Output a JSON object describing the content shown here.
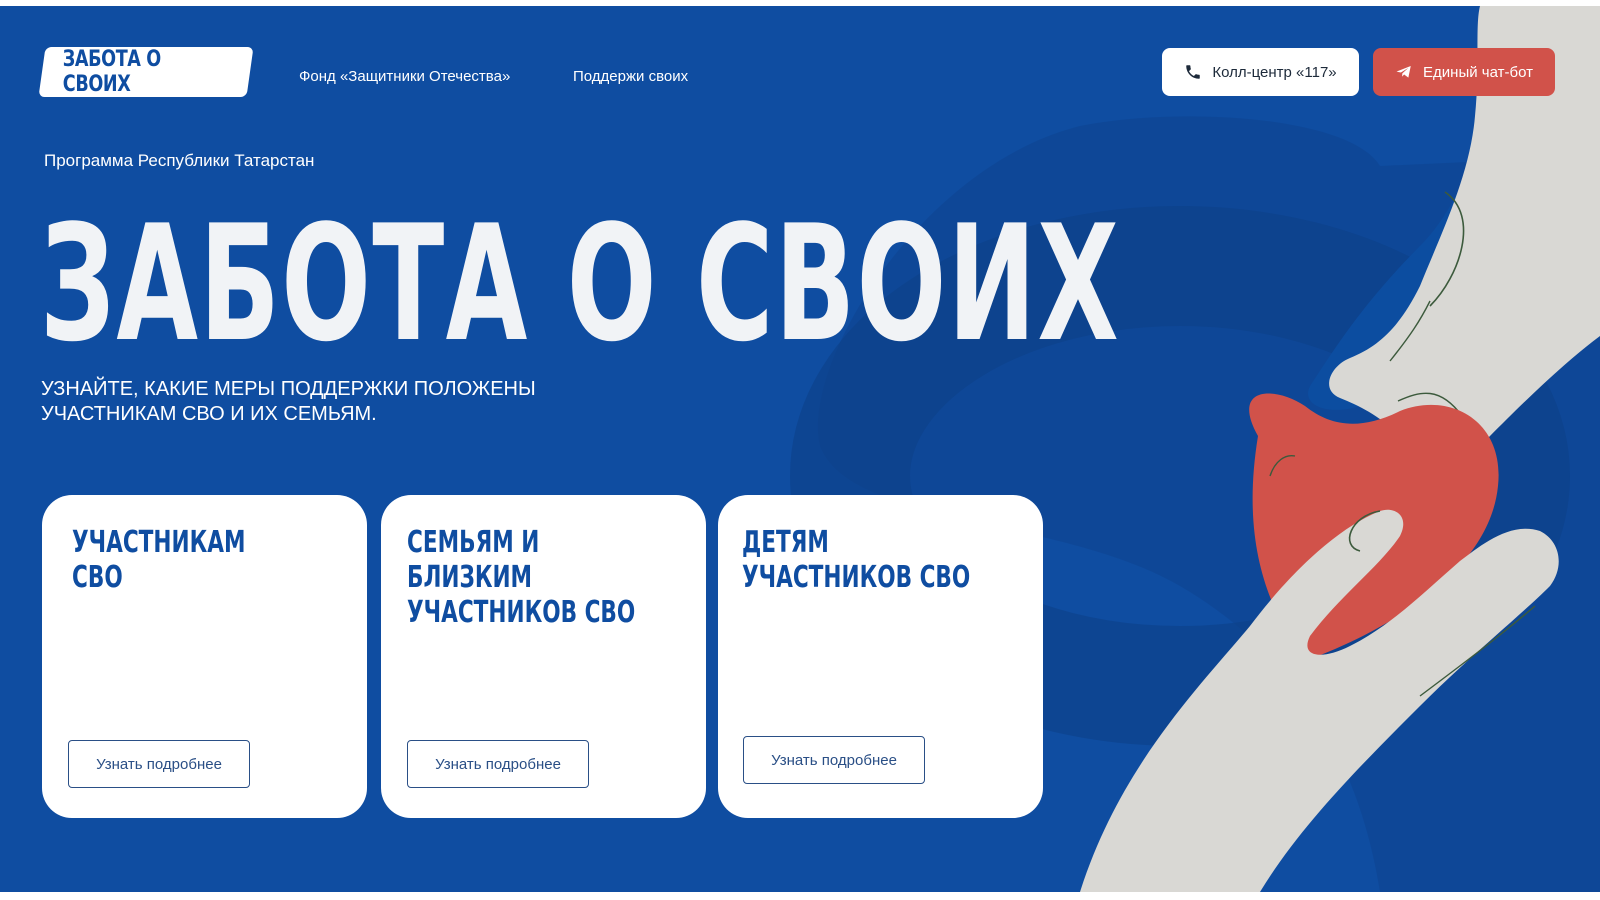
{
  "header": {
    "logo_text": "ЗАБОТА О СВОИХ",
    "nav": [
      {
        "label": "Фонд «Защитники Отечества»"
      },
      {
        "label": "Поддержи своих"
      }
    ],
    "call_center_label": "Колл-центр «117»",
    "chatbot_label": "Единый чат-бот"
  },
  "hero": {
    "program_label": "Программа Республики Татарстан",
    "title": "ЗАБОТА О СВОИХ",
    "subtitle_line1": "Узнайте, какие меры поддержки положены",
    "subtitle_line2": "участникам СВО и их семьям."
  },
  "cards": [
    {
      "title": "Участникам СВО",
      "button": "Узнать подробнее"
    },
    {
      "title": "Семьям и близким\nучастников СВО",
      "button": "Узнать подробнее"
    },
    {
      "title": "Детям\nучастников СВО",
      "button": "Узнать подробнее"
    }
  ],
  "icons": {
    "call": "phone-icon",
    "chat": "telegram-icon"
  },
  "colors": {
    "background": "#0f4da1",
    "heart": "#d1524a",
    "hands": "#d9d8d4",
    "chat_button": "#d1524a"
  }
}
